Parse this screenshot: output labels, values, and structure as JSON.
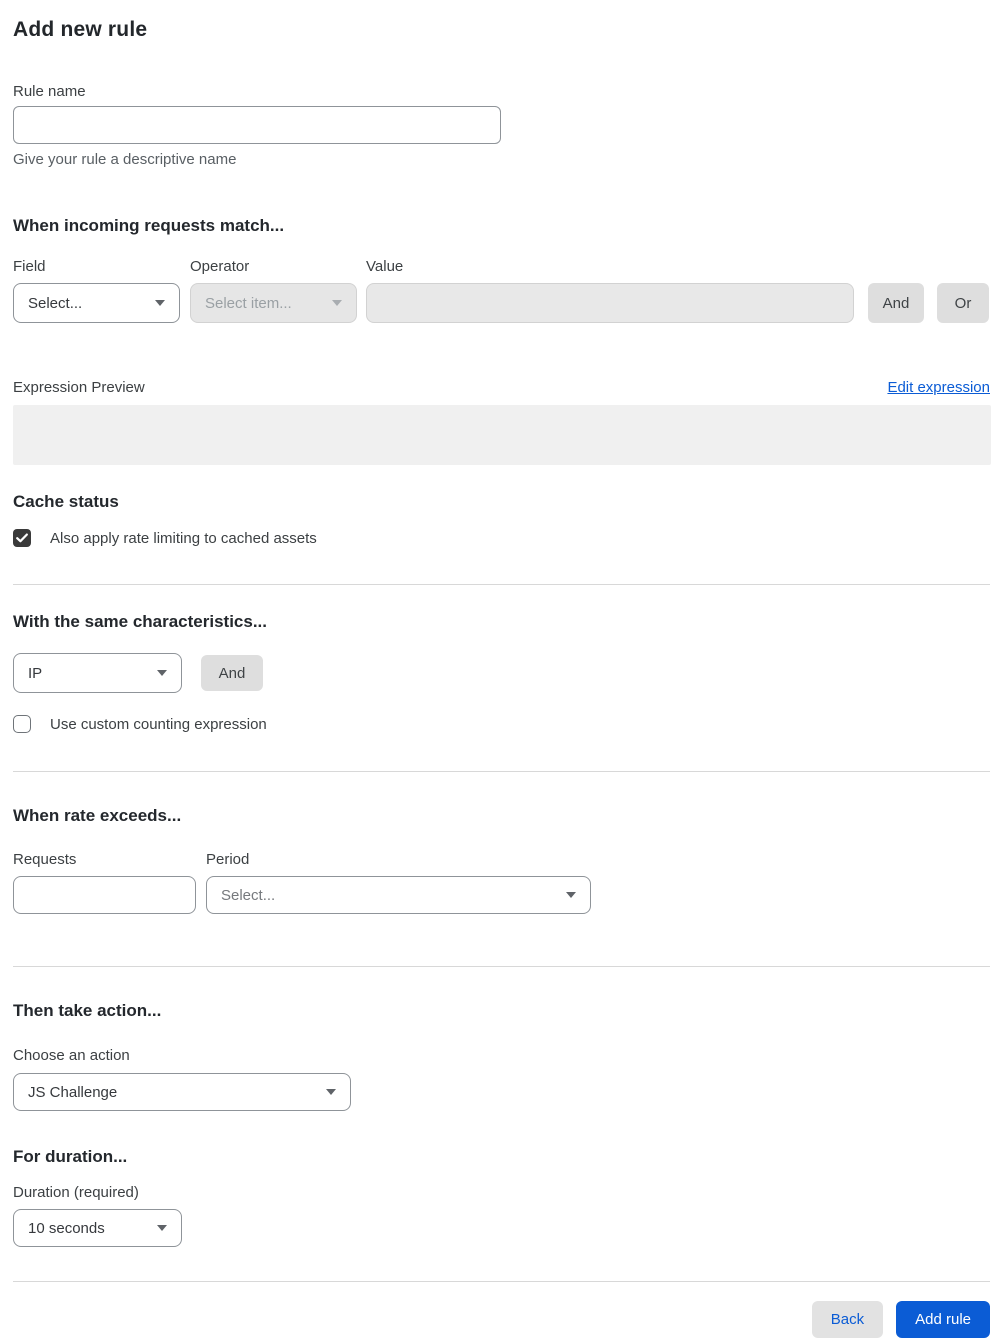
{
  "page": {
    "title": "Add new rule"
  },
  "rule_name": {
    "label": "Rule name",
    "value": "",
    "helper": "Give your rule a descriptive name"
  },
  "match": {
    "heading": "When incoming requests match...",
    "field": {
      "label": "Field",
      "selected": "Select..."
    },
    "operator": {
      "label": "Operator",
      "selected": "Select item..."
    },
    "value": {
      "label": "Value",
      "value": ""
    },
    "and_label": "And",
    "or_label": "Or",
    "expression_preview_label": "Expression Preview",
    "edit_expression_label": "Edit expression",
    "expression_value": ""
  },
  "cache": {
    "heading": "Cache status",
    "checkbox_label": "Also apply rate limiting to cached assets",
    "checked": true
  },
  "characteristics": {
    "heading": "With the same characteristics...",
    "selected": "IP",
    "and_label": "And",
    "checkbox_label": "Use custom counting expression",
    "checked": false
  },
  "rate": {
    "heading": "When rate exceeds...",
    "requests_label": "Requests",
    "requests_value": "",
    "period_label": "Period",
    "period_selected": "Select..."
  },
  "action": {
    "heading": "Then take action...",
    "choose_label": "Choose an action",
    "selected": "JS Challenge"
  },
  "duration": {
    "heading": "For duration...",
    "label": "Duration (required)",
    "selected": "10 seconds"
  },
  "footer": {
    "back_label": "Back",
    "add_label": "Add rule"
  },
  "colors": {
    "accent_blue": "#0b5cd5",
    "checkbox_dark": "#3a3a3a",
    "disabled_bg": "#e6e6e6",
    "divider": "#d8d8d8"
  }
}
